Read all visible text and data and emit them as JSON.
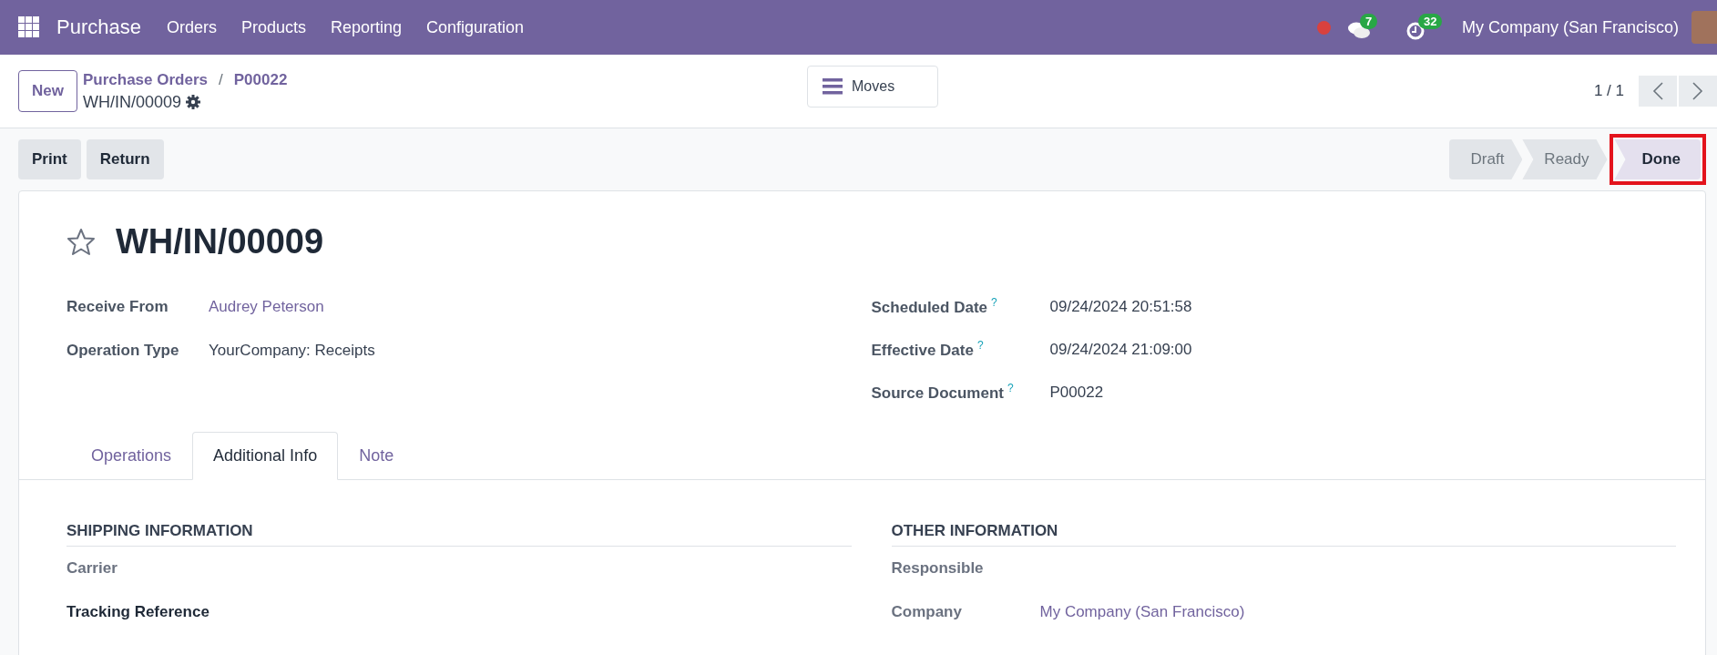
{
  "navbar": {
    "app_name": "Purchase",
    "menus": [
      "Orders",
      "Products",
      "Reporting",
      "Configuration"
    ],
    "messages_count": "7",
    "activities_count": "32",
    "company": "My Company (San Francisco)"
  },
  "control_panel": {
    "new_button": "New",
    "breadcrumbs": [
      "Purchase Orders",
      "P00022"
    ],
    "breadcrumb_separator": "/",
    "record_name": "WH/IN/00009",
    "smart_button": "Moves",
    "pager": "1 / 1"
  },
  "actions": [
    "Print",
    "Return"
  ],
  "stages": [
    {
      "label": "Draft",
      "selected": false,
      "highlighted": false
    },
    {
      "label": "Ready",
      "selected": false,
      "highlighted": false
    },
    {
      "label": "Done",
      "selected": true,
      "highlighted": true
    }
  ],
  "form": {
    "starred": false,
    "title": "WH/IN/00009",
    "left_fields": [
      {
        "label": "Receive From",
        "value": "Audrey Peterson",
        "link": true
      },
      {
        "label": "Operation Type",
        "value": "YourCompany: Receipts",
        "link": false
      }
    ],
    "right_fields": [
      {
        "label": "Scheduled Date",
        "help": "?",
        "value": "09/24/2024 20:51:58"
      },
      {
        "label": "Effective Date",
        "help": "?",
        "value": "09/24/2024 21:09:00"
      },
      {
        "label": "Source Document",
        "help": "?",
        "value": "P00022"
      }
    ],
    "tabs": [
      {
        "label": "Operations",
        "selected": false
      },
      {
        "label": "Additional Info",
        "selected": true
      },
      {
        "label": "Note",
        "selected": false
      }
    ],
    "shipping_information": {
      "heading": "SHIPPING INFORMATION",
      "rows": [
        {
          "label": "Carrier",
          "strong": false
        },
        {
          "label": "Tracking Reference",
          "strong": true
        }
      ]
    },
    "other_information": {
      "heading": "OTHER INFORMATION",
      "rows": [
        {
          "label": "Responsible"
        },
        {
          "label": "Company",
          "value": "My Company (San Francisco)"
        }
      ]
    }
  }
}
